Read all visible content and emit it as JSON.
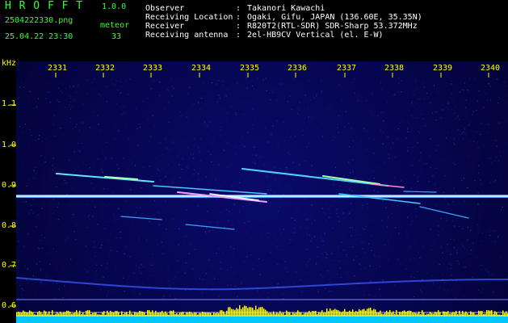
{
  "app": {
    "name": "H R O F F T",
    "version": "1.0.0"
  },
  "file": {
    "name": "2504222330.png",
    "datetime": "25.04.22 23:30"
  },
  "meteor": {
    "label": "meteor",
    "count": "33"
  },
  "info": [
    {
      "key": "Observer",
      "sep": ":",
      "value": "Takanori Kawachi"
    },
    {
      "key": "Receiving Location",
      "sep": ":",
      "value": "Ogaki, Gifu, JAPAN (136.60E, 35.35N)"
    },
    {
      "key": "Receiver",
      "sep": ":",
      "value": "R820T2(RTL-SDR) SDR-Sharp 53.372MHz"
    },
    {
      "key": "Receiving antenna",
      "sep": ":",
      "value": "2el-HB9CV Vertical (el. E-W)"
    }
  ],
  "axis": {
    "unit": "kHz",
    "x_ticks": [
      "2331",
      "2332",
      "2333",
      "2334",
      "2335",
      "2336",
      "2337",
      "2338",
      "2339",
      "2340"
    ],
    "y_ticks": [
      "1.1",
      "1.0",
      "0.9",
      "0.8",
      "0.7",
      "0.6"
    ]
  },
  "colors": {
    "accent_green": "#33ff33",
    "tick_yellow": "#ffff00",
    "text_white": "#ffffff",
    "background": "#000000",
    "spectrogram_blue": "#06064f",
    "level_cyan": "#00ccff"
  }
}
